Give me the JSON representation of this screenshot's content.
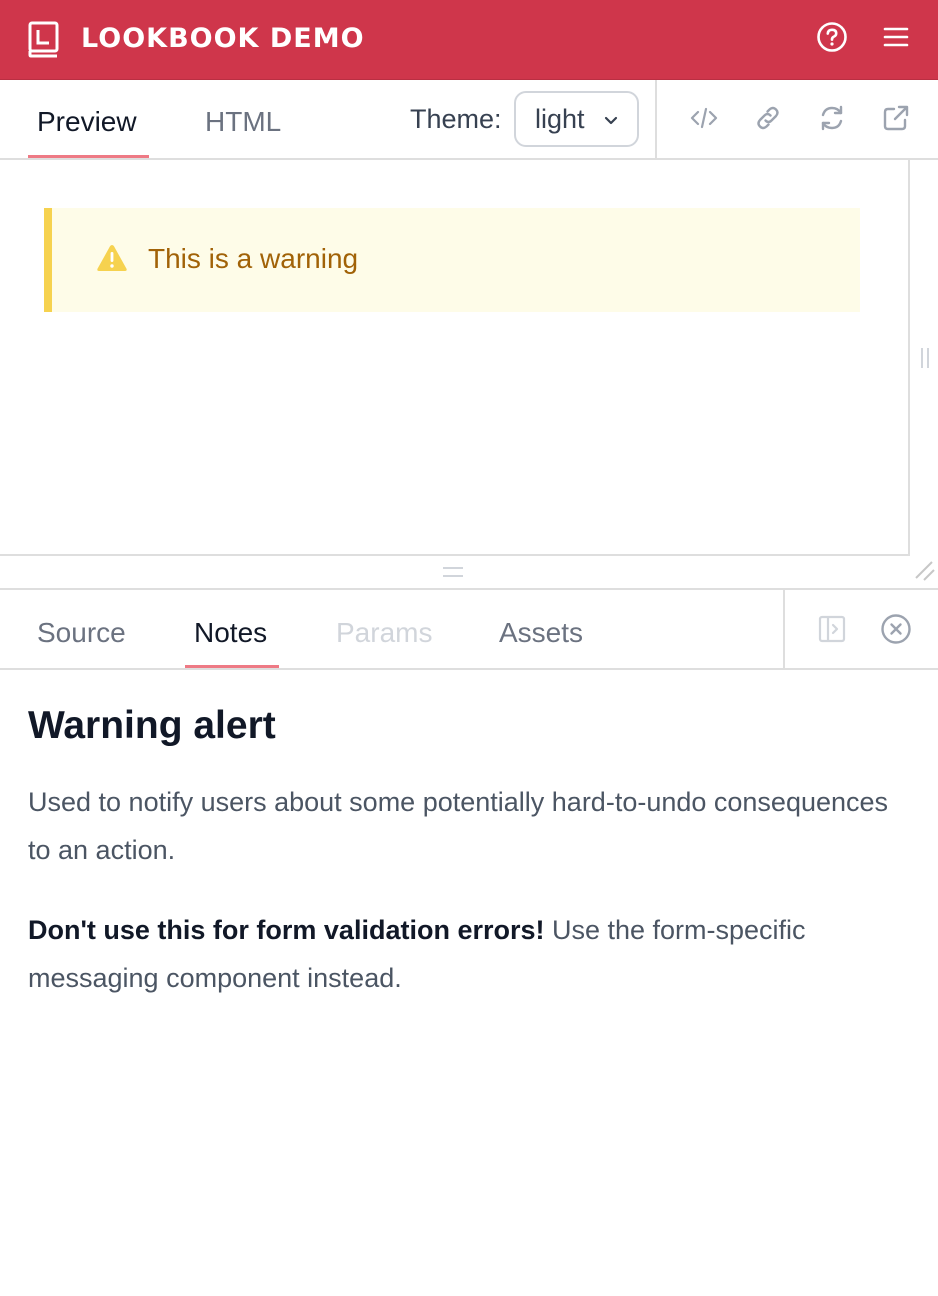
{
  "header": {
    "title": "LOOKBOOK DEMO",
    "logo_icon": "book-icon",
    "help_icon": "help-circle-icon",
    "menu_icon": "menu-icon",
    "background": "#cf364b"
  },
  "preview_tabs": {
    "tabs": [
      {
        "label": "Preview",
        "active": true
      },
      {
        "label": "HTML",
        "active": false
      }
    ],
    "theme_label": "Theme:",
    "theme_value": "light",
    "actions": [
      "code-icon",
      "link-icon",
      "refresh-icon",
      "external-link-icon"
    ]
  },
  "preview": {
    "alert": {
      "text": "This is a warning",
      "icon": "warning-triangle-icon",
      "accent": "#f6d24f",
      "background": "#fefce8",
      "text_color": "#a16207"
    }
  },
  "drawer": {
    "tabs": [
      {
        "label": "Source",
        "active": false,
        "disabled": false
      },
      {
        "label": "Notes",
        "active": true,
        "disabled": false
      },
      {
        "label": "Params",
        "active": false,
        "disabled": true
      },
      {
        "label": "Assets",
        "active": false,
        "disabled": false
      }
    ],
    "actions": [
      "toggle-sidebar-icon",
      "close-circle-icon"
    ]
  },
  "notes": {
    "heading": "Warning alert",
    "paragraph1": "Used to notify users about some potentially hard-to-undo consequences to an action.",
    "paragraph2_bold": "Don't use this for form validation errors!",
    "paragraph2_rest": " Use the form-specific messaging component instead."
  }
}
